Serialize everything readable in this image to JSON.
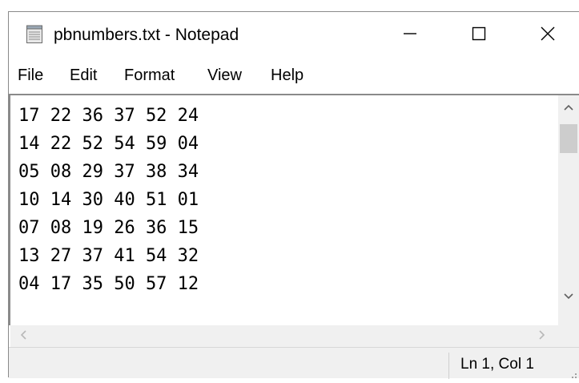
{
  "window": {
    "title": "pbnumbers.txt - Notepad",
    "app_icon": "notepad-icon",
    "controls": {
      "minimize": "minimize-icon",
      "maximize": "maximize-icon",
      "close": "close-icon"
    }
  },
  "menu": {
    "file": "File",
    "edit": "Edit",
    "format": "Format",
    "view": "View",
    "help": "Help"
  },
  "editor": {
    "lines": [
      "17 22 36 37 52 24",
      "14 22 52 54 59 04",
      "05 08 29 37 38 34",
      "10 14 30 40 51 01",
      "07 08 19 26 36 15",
      "13 27 37 41 54 32",
      "04 17 35 50 57 12"
    ]
  },
  "status": {
    "position": "Ln 1, Col 1"
  },
  "colors": {
    "chrome": "#f0f0f0",
    "border": "#8a8a8a",
    "scroll_thumb": "#cdcdcd"
  }
}
